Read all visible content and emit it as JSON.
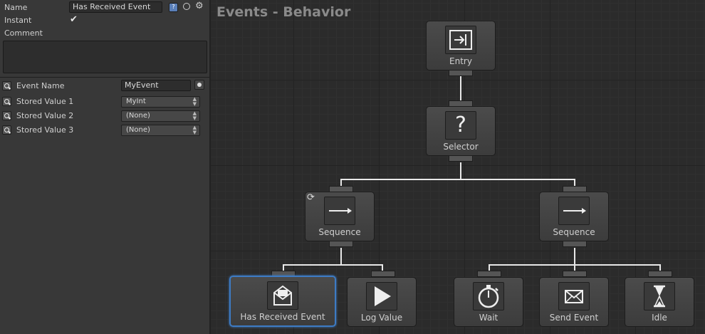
{
  "inspector": {
    "name_label": "Name",
    "name_value": "Has Received Event",
    "instant_label": "Instant",
    "instant_checked": true,
    "comment_label": "Comment",
    "comment_value": "",
    "event_name_label": "Event Name",
    "event_name_value": "MyEvent",
    "stored_values": [
      {
        "label": "Stored Value 1",
        "value": "MyInt"
      },
      {
        "label": "Stored Value 2",
        "value": "(None)"
      },
      {
        "label": "Stored Value 3",
        "value": "(None)"
      }
    ]
  },
  "graph": {
    "title": "Events - Behavior",
    "nodes": {
      "entry": "Entry",
      "selector": "Selector",
      "sequence_left": "Sequence",
      "sequence_right": "Sequence",
      "has_received_event": "Has Received Event",
      "log_value": "Log Value",
      "wait": "Wait",
      "send_event": "Send Event",
      "idle": "Idle"
    },
    "selected_node": "has_received_event"
  },
  "colors": {
    "selection": "#3d7bc4",
    "wire": "#e8e8e8",
    "panel": "#383838",
    "graph_bg": "#2b2b2b"
  }
}
